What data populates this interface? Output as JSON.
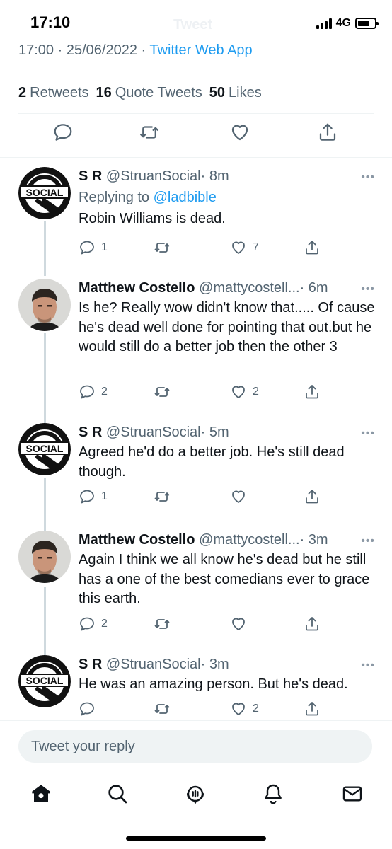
{
  "status_bar": {
    "time": "17:10",
    "network": "4G",
    "background_title": "Tweet"
  },
  "tweet_meta": {
    "time": "17:00",
    "separator": "·",
    "date": "25/06/2022",
    "source": "Twitter Web App"
  },
  "stats": [
    {
      "count": "2",
      "label": "Retweets"
    },
    {
      "count": "16",
      "label": "Quote Tweets"
    },
    {
      "count": "50",
      "label": "Likes"
    }
  ],
  "main_actions": [
    "reply-icon",
    "retweet-icon",
    "like-icon",
    "share-icon"
  ],
  "replies": [
    {
      "name": "S R",
      "handle": "@StruanSocial",
      "time": "· 8m",
      "replying_label": "Replying to",
      "replying_to": "@ladbible",
      "text": "Robin Williams is dead.",
      "reply_count": "1",
      "retweet_count": "",
      "like_count": "7",
      "avatar": "social-club-logo"
    },
    {
      "name": "Matthew Costello",
      "handle": "@mattycostell...",
      "time": "· 6m",
      "text": "Is he? Really wow didn't know that..... Of cause he's dead well done for pointing that out.but he would still do a better job then the other 3",
      "reply_count": "2",
      "retweet_count": "",
      "like_count": "2",
      "avatar": "profile-photo"
    },
    {
      "name": "S R",
      "handle": "@StruanSocial",
      "time": "· 5m",
      "text": "Agreed he'd do a better job. He's still dead though.",
      "reply_count": "1",
      "retweet_count": "",
      "like_count": "",
      "avatar": "social-club-logo"
    },
    {
      "name": "Matthew Costello",
      "handle": "@mattycostell...",
      "time": "· 3m",
      "text": "Again I think we all know he's dead but he still has a one of the best comedians ever to grace this earth.",
      "reply_count": "2",
      "retweet_count": "",
      "like_count": "",
      "avatar": "profile-photo"
    },
    {
      "name": "S R",
      "handle": "@StruanSocial",
      "time": "· 3m",
      "text": "He was an amazing person. But he's dead.",
      "reply_count": "",
      "retweet_count": "",
      "like_count": "2",
      "avatar": "social-club-logo"
    }
  ],
  "more_glyph": "•••",
  "reply_input": {
    "placeholder": "Tweet your reply",
    "value": ""
  },
  "tab_bar": [
    "home-icon",
    "search-icon",
    "spaces-icon",
    "notifications-icon",
    "messages-icon"
  ],
  "colors": {
    "accent": "#1d9bf0",
    "secondary_text": "#536471",
    "primary_text": "#0f1419",
    "thread_line": "#cfd9de"
  }
}
